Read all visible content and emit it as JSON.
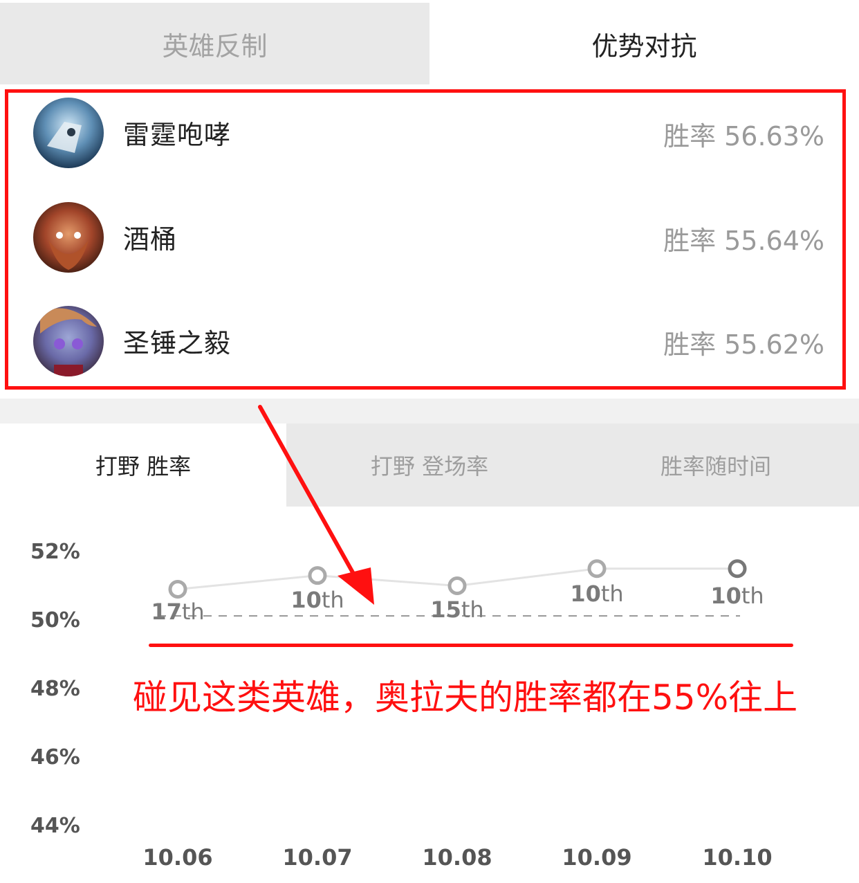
{
  "top_tabs": {
    "counter": "英雄反制",
    "advantage": "优势对抗"
  },
  "heroes": [
    {
      "name": "雷霆咆哮",
      "rate_label": "胜率",
      "rate": "56.63%"
    },
    {
      "name": "酒桶",
      "rate_label": "胜率",
      "rate": "55.64%"
    },
    {
      "name": "圣锤之毅",
      "rate_label": "胜率",
      "rate": "55.62%"
    }
  ],
  "sub_tabs": {
    "win_rate": "打野 胜率",
    "pick_rate": "打野 登场率",
    "over_time": "胜率随时间"
  },
  "annotation": "碰见这类英雄，奥拉夫的胜率都在55%往上",
  "colors": {
    "annotation_red": "#ff1010",
    "tab_inactive_bg": "#e9e9e9",
    "rate_gray": "#9a9a9a",
    "series_gray": "#aaaaaa"
  },
  "chart_data": {
    "type": "line",
    "x": [
      "10.06",
      "10.07",
      "10.08",
      "10.09",
      "10.10"
    ],
    "series": [
      {
        "values": [
          50.9,
          51.3,
          51.0,
          51.5,
          51.5
        ],
        "point_labels": [
          {
            "num": "17",
            "suffix": "th"
          },
          {
            "num": "10",
            "suffix": "th"
          },
          {
            "num": "15",
            "suffix": "th"
          },
          {
            "num": "10",
            "suffix": "th"
          },
          {
            "num": "10",
            "suffix": "th"
          }
        ]
      }
    ],
    "reference_line": 50,
    "y_ticks": [
      "52%",
      "50%",
      "48%",
      "46%",
      "44%"
    ],
    "ylim": [
      44,
      52
    ]
  }
}
